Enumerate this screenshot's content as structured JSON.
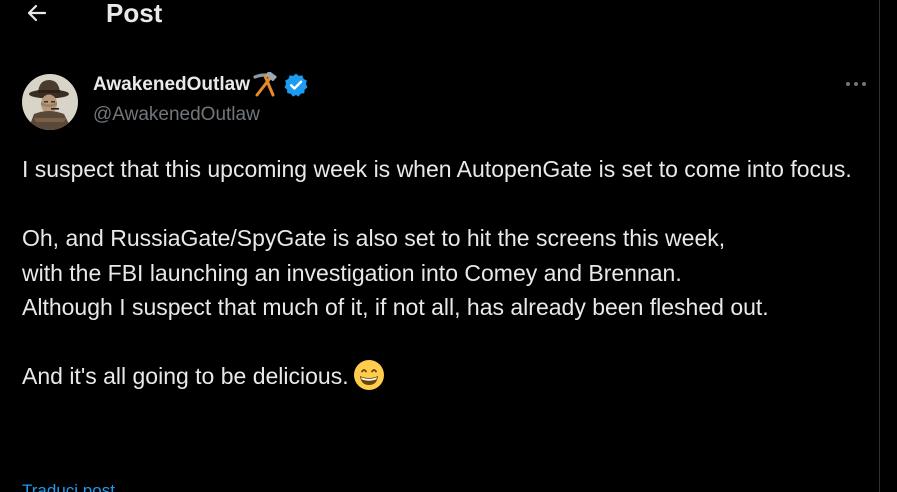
{
  "header": {
    "back_icon": "arrow-left-icon",
    "title": "Post"
  },
  "author": {
    "display_name": "AwakenedOutlaw",
    "name_emoji": "hammer-and-pick",
    "verified": true,
    "handle": "@AwakenedOutlaw",
    "avatar": "cowboy-portrait"
  },
  "more_icon": "ellipsis-icon",
  "tweet": {
    "paragraph_1": "I suspect that this upcoming week is when AutopenGate is set to come into focus.",
    "paragraph_2_line_1": "Oh, and RussiaGate/SpyGate is also set to hit the screens this week,",
    "paragraph_2_line_2": "with the FBI launching an investigation into Comey and Brennan.",
    "paragraph_2_line_3": "Although I suspect that much of it, if not all, has already been fleshed out.",
    "paragraph_3": "And it's all going to be delicious.",
    "paragraph_3_emoji": "grinning-face-with-smiling-eyes"
  },
  "translate_label": "Traduci post",
  "colors": {
    "background": "#000000",
    "text": "#e7e9ea",
    "secondary": "#71767b",
    "accent": "#1d9bf0",
    "divider": "#2f3336"
  }
}
